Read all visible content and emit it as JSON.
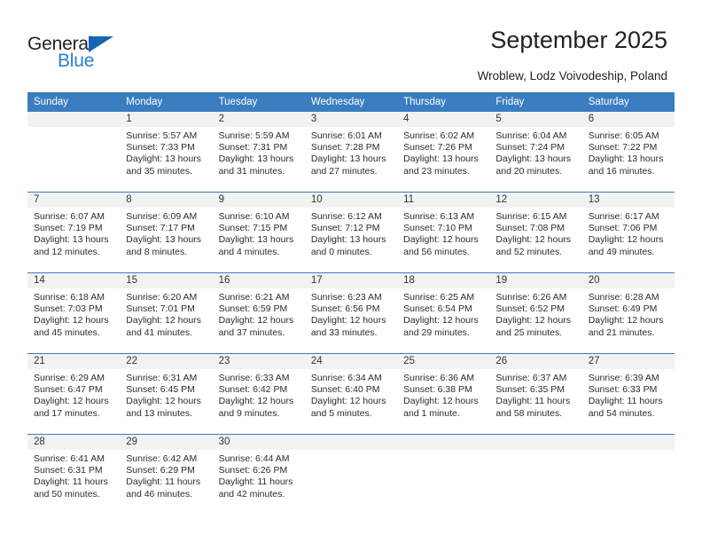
{
  "brand": {
    "name_top": "General",
    "name_bottom": "Blue",
    "triangle_color": "#1565b0",
    "blue_text_color": "#2a7fd4"
  },
  "header": {
    "title": "September 2025",
    "subtitle": "Wroblew, Lodz Voivodeship, Poland",
    "header_bg": "#3a7dc0",
    "header_text_color": "#ffffff",
    "daynum_bg": "#f2f2f2"
  },
  "weekdays": [
    "Sunday",
    "Monday",
    "Tuesday",
    "Wednesday",
    "Thursday",
    "Friday",
    "Saturday"
  ],
  "labels": {
    "sunrise_prefix": "Sunrise:",
    "sunset_prefix": "Sunset:",
    "daylight_prefix": "Daylight:"
  },
  "weeks": [
    [
      {
        "day": "",
        "empty": true,
        "sunrise": "",
        "sunset": "",
        "daylight_line1": "",
        "daylight_line2": ""
      },
      {
        "day": "1",
        "empty": false,
        "sunrise": "Sunrise: 5:57 AM",
        "sunset": "Sunset: 7:33 PM",
        "daylight_line1": "Daylight: 13 hours",
        "daylight_line2": "and 35 minutes."
      },
      {
        "day": "2",
        "empty": false,
        "sunrise": "Sunrise: 5:59 AM",
        "sunset": "Sunset: 7:31 PM",
        "daylight_line1": "Daylight: 13 hours",
        "daylight_line2": "and 31 minutes."
      },
      {
        "day": "3",
        "empty": false,
        "sunrise": "Sunrise: 6:01 AM",
        "sunset": "Sunset: 7:28 PM",
        "daylight_line1": "Daylight: 13 hours",
        "daylight_line2": "and 27 minutes."
      },
      {
        "day": "4",
        "empty": false,
        "sunrise": "Sunrise: 6:02 AM",
        "sunset": "Sunset: 7:26 PM",
        "daylight_line1": "Daylight: 13 hours",
        "daylight_line2": "and 23 minutes."
      },
      {
        "day": "5",
        "empty": false,
        "sunrise": "Sunrise: 6:04 AM",
        "sunset": "Sunset: 7:24 PM",
        "daylight_line1": "Daylight: 13 hours",
        "daylight_line2": "and 20 minutes."
      },
      {
        "day": "6",
        "empty": false,
        "sunrise": "Sunrise: 6:05 AM",
        "sunset": "Sunset: 7:22 PM",
        "daylight_line1": "Daylight: 13 hours",
        "daylight_line2": "and 16 minutes."
      }
    ],
    [
      {
        "day": "7",
        "empty": false,
        "sunrise": "Sunrise: 6:07 AM",
        "sunset": "Sunset: 7:19 PM",
        "daylight_line1": "Daylight: 13 hours",
        "daylight_line2": "and 12 minutes."
      },
      {
        "day": "8",
        "empty": false,
        "sunrise": "Sunrise: 6:09 AM",
        "sunset": "Sunset: 7:17 PM",
        "daylight_line1": "Daylight: 13 hours",
        "daylight_line2": "and 8 minutes."
      },
      {
        "day": "9",
        "empty": false,
        "sunrise": "Sunrise: 6:10 AM",
        "sunset": "Sunset: 7:15 PM",
        "daylight_line1": "Daylight: 13 hours",
        "daylight_line2": "and 4 minutes."
      },
      {
        "day": "10",
        "empty": false,
        "sunrise": "Sunrise: 6:12 AM",
        "sunset": "Sunset: 7:12 PM",
        "daylight_line1": "Daylight: 13 hours",
        "daylight_line2": "and 0 minutes."
      },
      {
        "day": "11",
        "empty": false,
        "sunrise": "Sunrise: 6:13 AM",
        "sunset": "Sunset: 7:10 PM",
        "daylight_line1": "Daylight: 12 hours",
        "daylight_line2": "and 56 minutes."
      },
      {
        "day": "12",
        "empty": false,
        "sunrise": "Sunrise: 6:15 AM",
        "sunset": "Sunset: 7:08 PM",
        "daylight_line1": "Daylight: 12 hours",
        "daylight_line2": "and 52 minutes."
      },
      {
        "day": "13",
        "empty": false,
        "sunrise": "Sunrise: 6:17 AM",
        "sunset": "Sunset: 7:06 PM",
        "daylight_line1": "Daylight: 12 hours",
        "daylight_line2": "and 49 minutes."
      }
    ],
    [
      {
        "day": "14",
        "empty": false,
        "sunrise": "Sunrise: 6:18 AM",
        "sunset": "Sunset: 7:03 PM",
        "daylight_line1": "Daylight: 12 hours",
        "daylight_line2": "and 45 minutes."
      },
      {
        "day": "15",
        "empty": false,
        "sunrise": "Sunrise: 6:20 AM",
        "sunset": "Sunset: 7:01 PM",
        "daylight_line1": "Daylight: 12 hours",
        "daylight_line2": "and 41 minutes."
      },
      {
        "day": "16",
        "empty": false,
        "sunrise": "Sunrise: 6:21 AM",
        "sunset": "Sunset: 6:59 PM",
        "daylight_line1": "Daylight: 12 hours",
        "daylight_line2": "and 37 minutes."
      },
      {
        "day": "17",
        "empty": false,
        "sunrise": "Sunrise: 6:23 AM",
        "sunset": "Sunset: 6:56 PM",
        "daylight_line1": "Daylight: 12 hours",
        "daylight_line2": "and 33 minutes."
      },
      {
        "day": "18",
        "empty": false,
        "sunrise": "Sunrise: 6:25 AM",
        "sunset": "Sunset: 6:54 PM",
        "daylight_line1": "Daylight: 12 hours",
        "daylight_line2": "and 29 minutes."
      },
      {
        "day": "19",
        "empty": false,
        "sunrise": "Sunrise: 6:26 AM",
        "sunset": "Sunset: 6:52 PM",
        "daylight_line1": "Daylight: 12 hours",
        "daylight_line2": "and 25 minutes."
      },
      {
        "day": "20",
        "empty": false,
        "sunrise": "Sunrise: 6:28 AM",
        "sunset": "Sunset: 6:49 PM",
        "daylight_line1": "Daylight: 12 hours",
        "daylight_line2": "and 21 minutes."
      }
    ],
    [
      {
        "day": "21",
        "empty": false,
        "sunrise": "Sunrise: 6:29 AM",
        "sunset": "Sunset: 6:47 PM",
        "daylight_line1": "Daylight: 12 hours",
        "daylight_line2": "and 17 minutes."
      },
      {
        "day": "22",
        "empty": false,
        "sunrise": "Sunrise: 6:31 AM",
        "sunset": "Sunset: 6:45 PM",
        "daylight_line1": "Daylight: 12 hours",
        "daylight_line2": "and 13 minutes."
      },
      {
        "day": "23",
        "empty": false,
        "sunrise": "Sunrise: 6:33 AM",
        "sunset": "Sunset: 6:42 PM",
        "daylight_line1": "Daylight: 12 hours",
        "daylight_line2": "and 9 minutes."
      },
      {
        "day": "24",
        "empty": false,
        "sunrise": "Sunrise: 6:34 AM",
        "sunset": "Sunset: 6:40 PM",
        "daylight_line1": "Daylight: 12 hours",
        "daylight_line2": "and 5 minutes."
      },
      {
        "day": "25",
        "empty": false,
        "sunrise": "Sunrise: 6:36 AM",
        "sunset": "Sunset: 6:38 PM",
        "daylight_line1": "Daylight: 12 hours",
        "daylight_line2": "and 1 minute."
      },
      {
        "day": "26",
        "empty": false,
        "sunrise": "Sunrise: 6:37 AM",
        "sunset": "Sunset: 6:35 PM",
        "daylight_line1": "Daylight: 11 hours",
        "daylight_line2": "and 58 minutes."
      },
      {
        "day": "27",
        "empty": false,
        "sunrise": "Sunrise: 6:39 AM",
        "sunset": "Sunset: 6:33 PM",
        "daylight_line1": "Daylight: 11 hours",
        "daylight_line2": "and 54 minutes."
      }
    ],
    [
      {
        "day": "28",
        "empty": false,
        "sunrise": "Sunrise: 6:41 AM",
        "sunset": "Sunset: 6:31 PM",
        "daylight_line1": "Daylight: 11 hours",
        "daylight_line2": "and 50 minutes."
      },
      {
        "day": "29",
        "empty": false,
        "sunrise": "Sunrise: 6:42 AM",
        "sunset": "Sunset: 6:29 PM",
        "daylight_line1": "Daylight: 11 hours",
        "daylight_line2": "and 46 minutes."
      },
      {
        "day": "30",
        "empty": false,
        "sunrise": "Sunrise: 6:44 AM",
        "sunset": "Sunset: 6:26 PM",
        "daylight_line1": "Daylight: 11 hours",
        "daylight_line2": "and 42 minutes."
      },
      {
        "day": "",
        "empty": true,
        "sunrise": "",
        "sunset": "",
        "daylight_line1": "",
        "daylight_line2": ""
      },
      {
        "day": "",
        "empty": true,
        "sunrise": "",
        "sunset": "",
        "daylight_line1": "",
        "daylight_line2": ""
      },
      {
        "day": "",
        "empty": true,
        "sunrise": "",
        "sunset": "",
        "daylight_line1": "",
        "daylight_line2": ""
      },
      {
        "day": "",
        "empty": true,
        "sunrise": "",
        "sunset": "",
        "daylight_line1": "",
        "daylight_line2": ""
      }
    ]
  ]
}
